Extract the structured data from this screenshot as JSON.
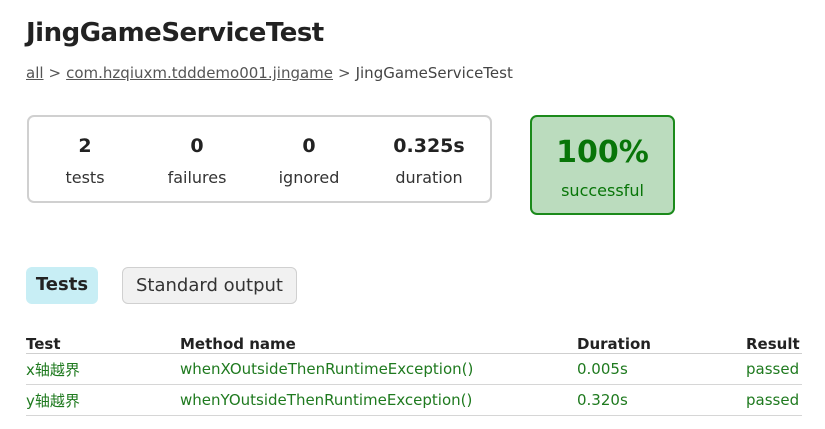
{
  "page": {
    "title": "JingGameServiceTest"
  },
  "breadcrumb": {
    "items": [
      "all",
      "com.hzqiuxm.tdddemo001.jingame",
      "JingGameServiceTest"
    ],
    "separator": ">"
  },
  "summary": {
    "counters": [
      {
        "value": "2",
        "label": "tests"
      },
      {
        "value": "0",
        "label": "failures"
      },
      {
        "value": "0",
        "label": "ignored"
      },
      {
        "value": "0.325s",
        "label": "duration"
      }
    ],
    "success": {
      "value": "100%",
      "label": "successful",
      "color": "#087508",
      "background": "#bbdcbe"
    }
  },
  "tabs": [
    {
      "label": "Tests",
      "selected": true
    },
    {
      "label": "Standard output",
      "selected": false
    }
  ],
  "table": {
    "headers": [
      "Test",
      "Method name",
      "Duration",
      "Result"
    ],
    "rows": [
      {
        "test": "x轴越界",
        "method": "whenXOutsideThenRuntimeException()",
        "duration": "0.005s",
        "result": "passed"
      },
      {
        "test": "y轴越界",
        "method": "whenYOutsideThenRuntimeException()",
        "duration": "0.320s",
        "result": "passed"
      }
    ],
    "pass_color": "#1f7a1f"
  }
}
